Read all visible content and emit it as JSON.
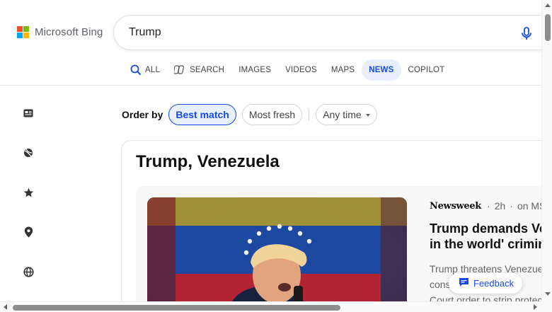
{
  "brand": {
    "name": "Microsoft Bing",
    "logo_colors": [
      "#f25022",
      "#7fba00",
      "#00a4ef",
      "#ffb900"
    ]
  },
  "search": {
    "value": "Trump",
    "mic_icon": "microphone-icon"
  },
  "tabs": [
    {
      "label": "ALL",
      "icon": "search-icon"
    },
    {
      "label": "SEARCH",
      "icon": "copilot-search-icon"
    },
    {
      "label": "IMAGES"
    },
    {
      "label": "VIDEOS"
    },
    {
      "label": "MAPS"
    },
    {
      "label": "NEWS",
      "active": true
    },
    {
      "label": "COPILOT"
    }
  ],
  "rail_icons": [
    "news-icon",
    "sports-icon",
    "favorites-icon",
    "location-icon",
    "world-icon"
  ],
  "filters": {
    "order_label": "Order by",
    "best_match": "Best match",
    "most_fresh": "Most fresh",
    "time": "Any time"
  },
  "topic": {
    "title": "Trump, Venezuela",
    "article": {
      "source": "Newsweek",
      "separator": "·",
      "age": "2h",
      "via": "on MSN",
      "headline_line1": "Trump demands Ve",
      "headline_line2": "in the world' crimir",
      "snippet_line1": "Trump threatens Venezue",
      "snippet_line2": "cons                   is a",
      "snippet_line3": "Court order to strip protec"
    }
  },
  "feedback": {
    "label": "Feedback",
    "icon": "feedback-icon"
  },
  "colors": {
    "accent": "#174ae4",
    "active_tab_bg": "#e8eefc",
    "selected_pill_bg": "#e7f0fb"
  }
}
